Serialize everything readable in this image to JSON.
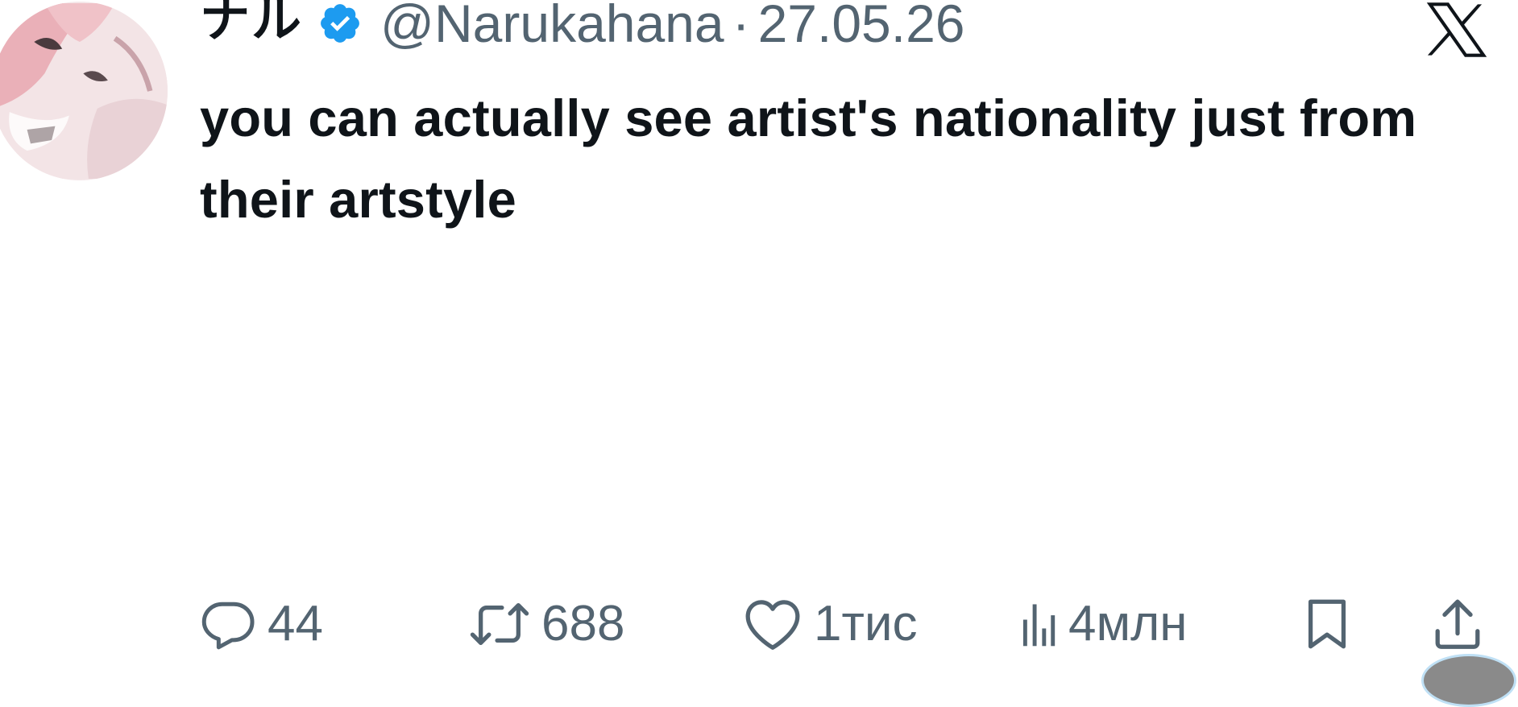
{
  "author": {
    "display_name": "ナル",
    "handle": "@Narukahana",
    "separator": "·",
    "date": "27.05.26",
    "verified_icon": "verified-badge-icon",
    "verified_color": "#1d9bf0"
  },
  "platform": {
    "logo_icon": "x-logo-icon"
  },
  "tweet": {
    "text": "you can actually see artist's nationality just from their artstyle"
  },
  "actions": {
    "reply": {
      "icon": "reply-icon",
      "count": "44"
    },
    "retweet": {
      "icon": "retweet-icon",
      "count": "688"
    },
    "like": {
      "icon": "heart-icon",
      "count": "1тис"
    },
    "views": {
      "icon": "views-chart-icon",
      "count": "4млн"
    },
    "bookmark": {
      "icon": "bookmark-icon"
    },
    "share": {
      "icon": "share-icon"
    }
  },
  "colors": {
    "text": "#0f1419",
    "secondary": "#536471",
    "background": "#ffffff"
  }
}
